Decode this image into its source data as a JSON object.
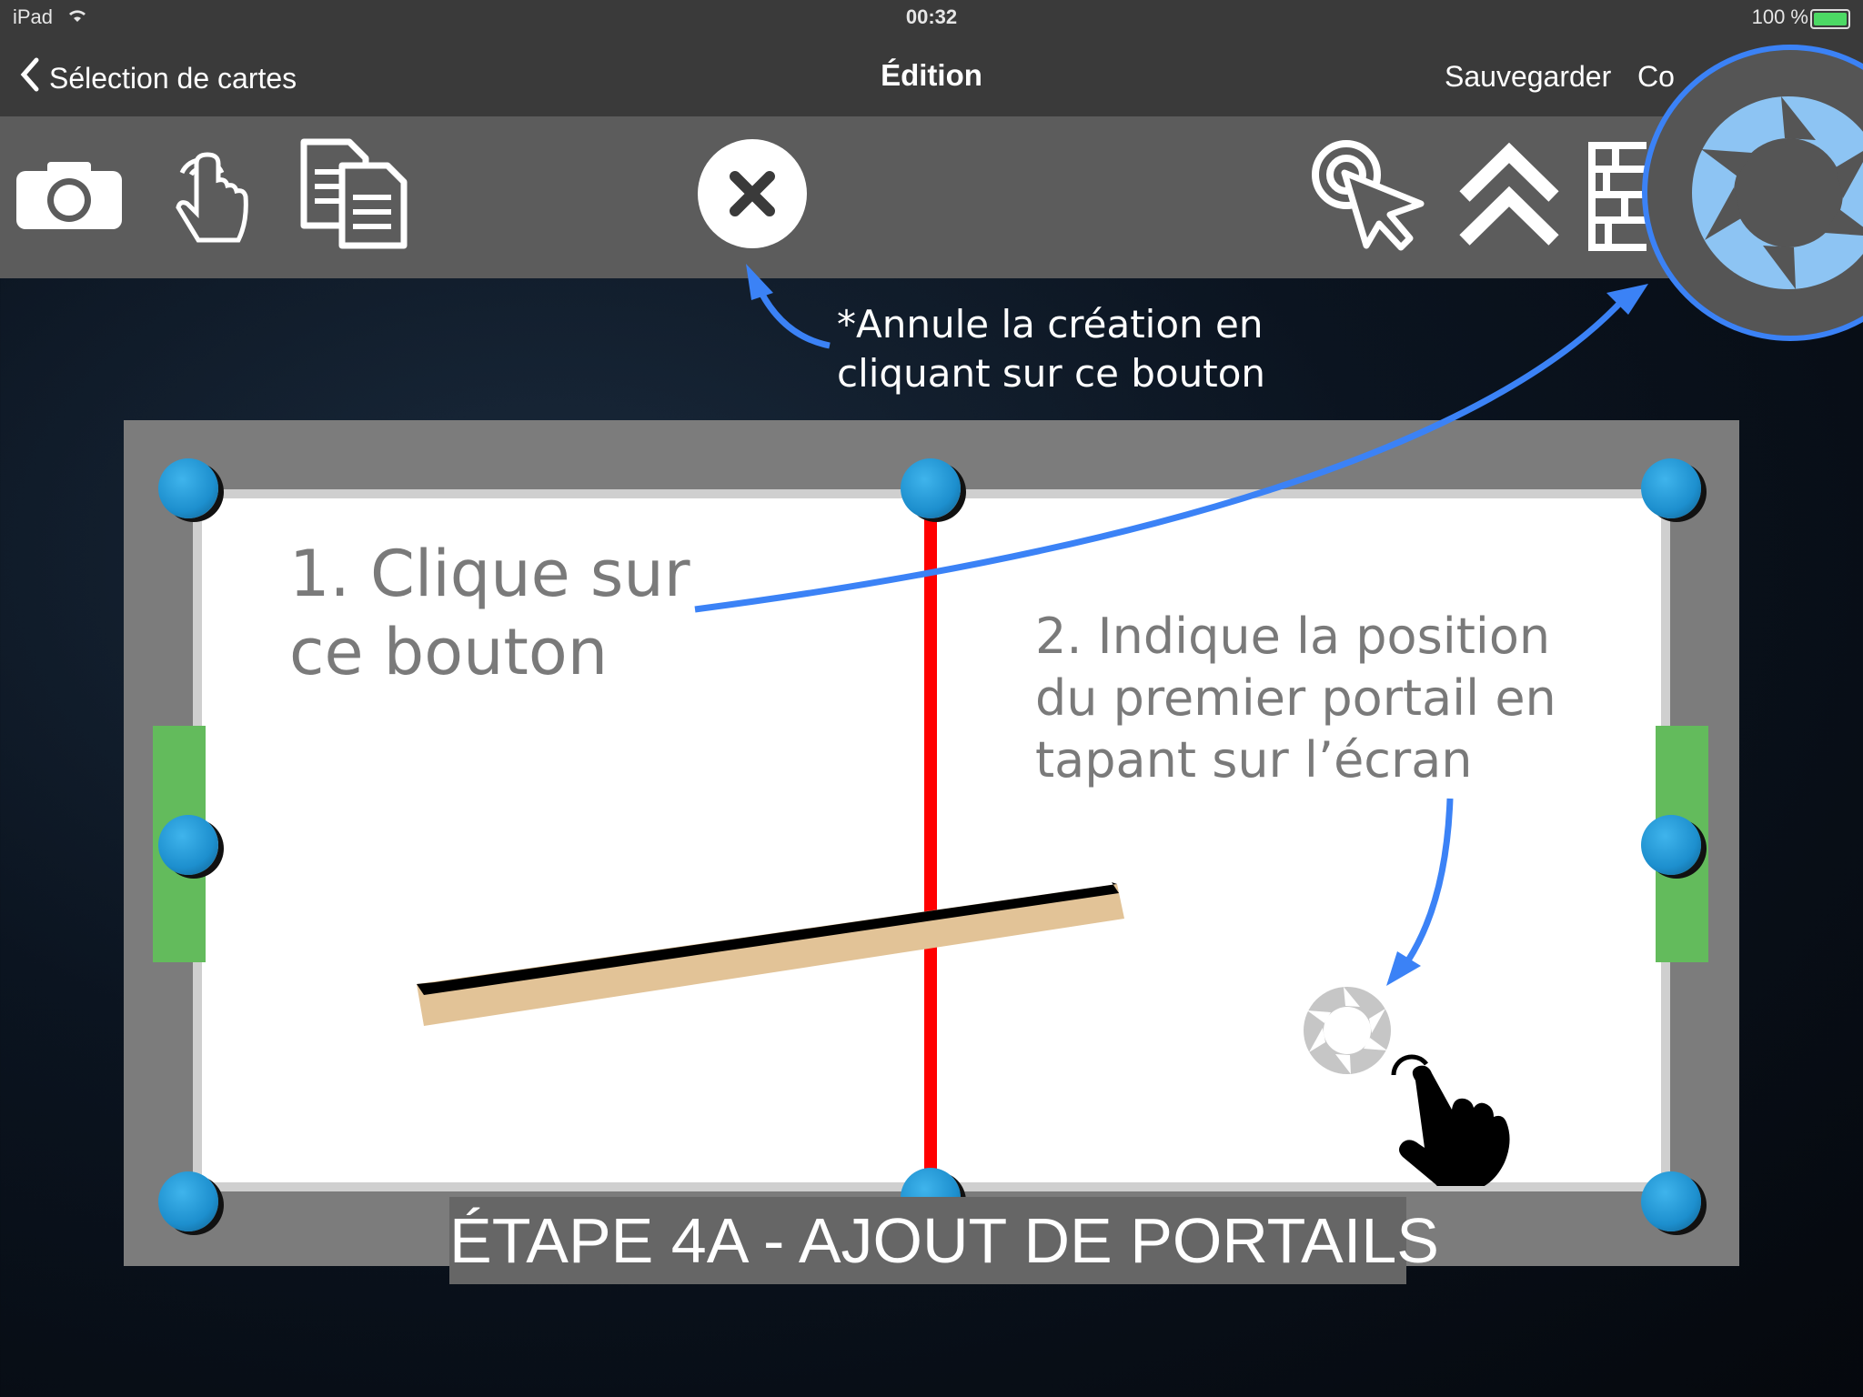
{
  "status_bar": {
    "device": "iPad",
    "time": "00:32",
    "battery": "100 %"
  },
  "nav": {
    "back_label": "Sélection de cartes",
    "title": "Édition",
    "save_label": "Sauvegarder",
    "next_label_partial": "Co"
  },
  "toolbar": {
    "icons": [
      "camera-icon",
      "tap-hand-icon",
      "copy-icon",
      "close-icon",
      "target-cursor-icon",
      "double-chevron-up-icon",
      "wall-icon",
      "portal-icon"
    ]
  },
  "annotations": {
    "cancel_note_line1": "*Annule la création en",
    "cancel_note_line2": "cliquant sur ce bouton",
    "step1_line1": "1. Clique sur",
    "step1_line2": "ce bouton",
    "step2_line1": "2. Indique la position",
    "step2_line2": "du premier portail en",
    "step2_line3": "tapant sur l’écran"
  },
  "caption": "ÉTAPE 4A - AJOUT DE PORTAILS",
  "colors": {
    "accent_blue": "#3b82f6",
    "goal_green": "#63bb5c",
    "red_line": "#ff0000",
    "ball_blue": "#1d8fce"
  }
}
